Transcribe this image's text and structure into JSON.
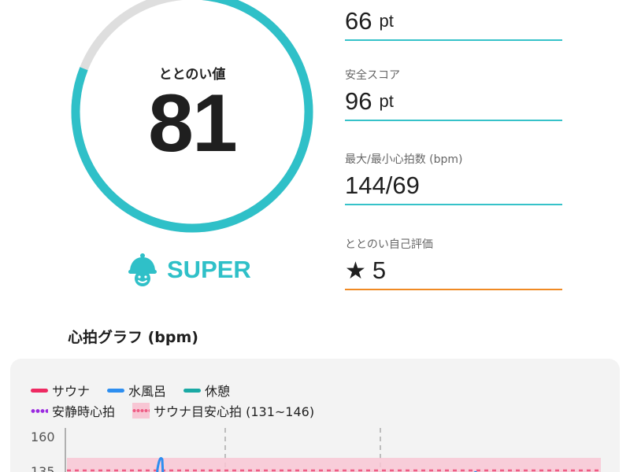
{
  "gauge": {
    "label": "ととのい値",
    "value": "81",
    "score": 81,
    "max": 100,
    "track_color": "#dedede",
    "fill_color": "#2fc0c8"
  },
  "rank": {
    "icon": "sauna-hat-face-icon",
    "label": "SUPER"
  },
  "stats": [
    {
      "label": "",
      "value": "66",
      "unit": "pt"
    },
    {
      "label": "安全スコア",
      "value": "96",
      "unit": "pt"
    },
    {
      "label": "最大/最小心拍数 (bpm)",
      "value": "144/69",
      "unit": ""
    },
    {
      "label": "ととのい自己評価",
      "value": "5",
      "unit": "",
      "icon": "star-icon"
    }
  ],
  "graph": {
    "title": "心拍グラフ (bpm)",
    "legend": [
      {
        "label": "サウナ",
        "color": "#ee2a62",
        "style": "line"
      },
      {
        "label": "水風呂",
        "color": "#2d8ef0",
        "style": "line"
      },
      {
        "label": "休憩",
        "color": "#1aa9a4",
        "style": "line"
      },
      {
        "label": "安静時心拍",
        "color": "#9b2be0",
        "style": "dotted"
      },
      {
        "label": "サウナ目安心拍 (131~146)",
        "color": "#ee5d85",
        "style": "band"
      }
    ],
    "y_ticks": [
      "160",
      "135"
    ]
  }
}
